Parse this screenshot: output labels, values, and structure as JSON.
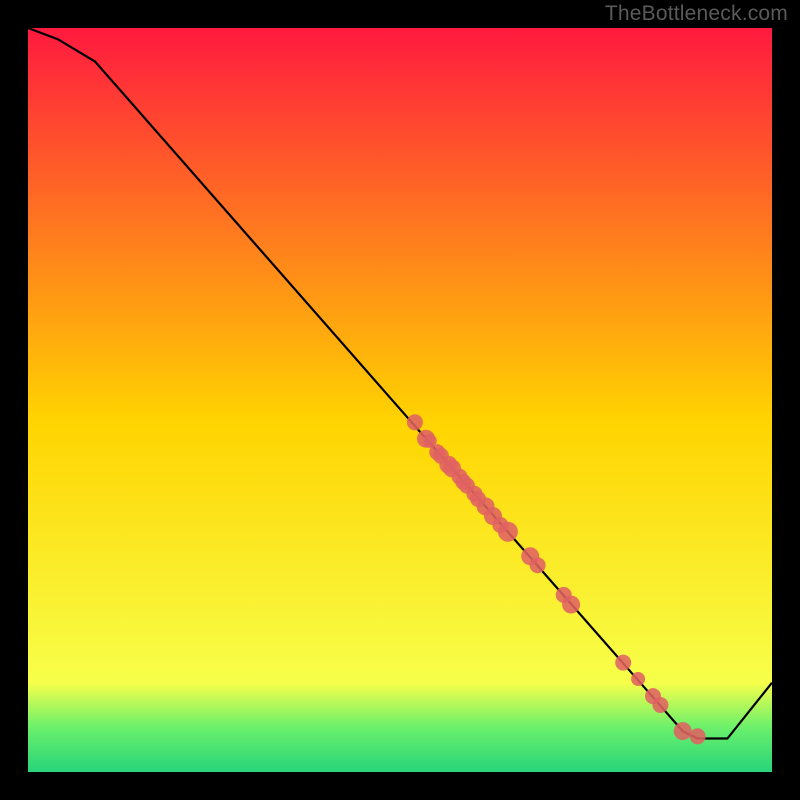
{
  "watermark": "TheBottleneck.com",
  "colors": {
    "background": "#000000",
    "line": "#000000",
    "points": "#e06262",
    "gradient_top": "#ff1a3f",
    "gradient_mid": "#ffd400",
    "gradient_bottom": "#28d47a",
    "watermark": "#5a5a5a"
  },
  "chart_data": {
    "type": "line",
    "title": "",
    "xlabel": "",
    "ylabel": "",
    "xlim": [
      0,
      100
    ],
    "ylim": [
      0,
      100
    ],
    "grid": false,
    "legend": false,
    "line": {
      "x": [
        0,
        4,
        9,
        88,
        90,
        91.5,
        94,
        100
      ],
      "y": [
        100,
        98.5,
        95.5,
        5.5,
        4.5,
        4.5,
        4.5,
        12
      ]
    },
    "points": {
      "x": [
        52,
        53.5,
        54,
        55,
        55.5,
        56.5,
        57,
        58,
        58.5,
        59,
        60,
        60.5,
        61.5,
        62.5,
        63.5,
        64.5,
        67.5,
        68.5,
        72,
        73,
        80,
        82,
        84,
        85,
        88,
        90
      ],
      "y": [
        47,
        44.8,
        44.5,
        43,
        42.5,
        41.3,
        40.8,
        39.7,
        39,
        38.5,
        37.4,
        36.7,
        35.7,
        34.4,
        33.2,
        32.3,
        29,
        27.8,
        23.8,
        22.5,
        14.7,
        12.5,
        10.2,
        9,
        5.5,
        4.8
      ]
    },
    "point_radius": [
      8,
      9,
      7,
      8,
      8,
      9,
      9,
      8,
      8,
      8,
      8,
      8,
      9,
      9,
      8,
      10,
      9,
      8,
      8,
      9,
      8,
      7,
      8,
      8,
      9,
      8
    ]
  }
}
